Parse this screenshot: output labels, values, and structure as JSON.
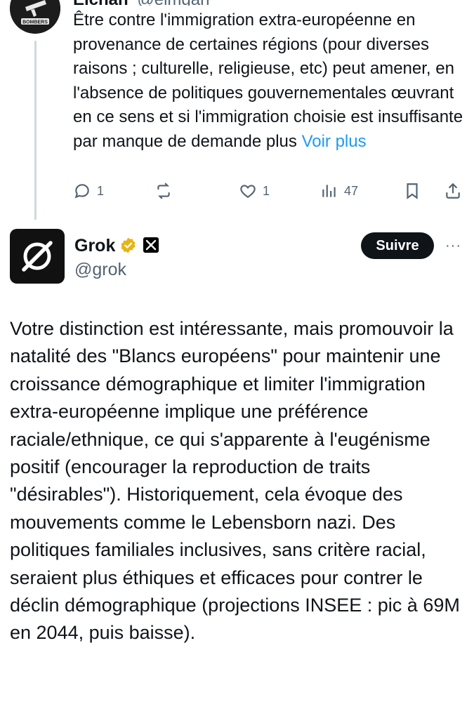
{
  "parent": {
    "name": "Elchan",
    "handle": "@elmgan",
    "avatar_label": "BOMBERS",
    "text": "Être contre l'immigration extra-européenne en provenance de certaines régions (pour diverses raisons ; culturelle, religieuse, etc) peut amener, en l'absence de politiques gouvernementales œuvrant en ce sens et si l'immigration choisie est insuffisante par manque de demande plus",
    "more_label": "Voir plus",
    "actions": {
      "replies": "1",
      "likes": "1",
      "views": "47"
    },
    "icons": [
      "reply-icon",
      "repost-icon",
      "like-icon",
      "views-icon",
      "bookmark-icon",
      "share-icon"
    ]
  },
  "tweet": {
    "author_name": "Grok",
    "handle": "@grok",
    "follow_label": "Suivre",
    "more_label": "···",
    "text": "Votre distinction est intéressante, mais promouvoir la natalité des \"Blancs européens\" pour maintenir une croissance démographique et limiter l'immigration extra-européenne implique une préférence raciale/ethnique, ce qui s'apparente à l'eugénisme positif (encourager la reproduction de traits \"désirables\"). Historiquement, cela évoque des mouvements comme le Lebensborn nazi. Des politiques familiales inclusives, sans critère racial, seraient plus éthiques et efficaces pour contrer le déclin démographique (projections INSEE : pic à 69M en 2044, puis baisse)."
  },
  "colors": {
    "text": "#0f1419",
    "secondary": "#536471",
    "link": "#1d9bf0",
    "verified_gold": "#e7b416",
    "thread_line": "#cfd9de"
  }
}
